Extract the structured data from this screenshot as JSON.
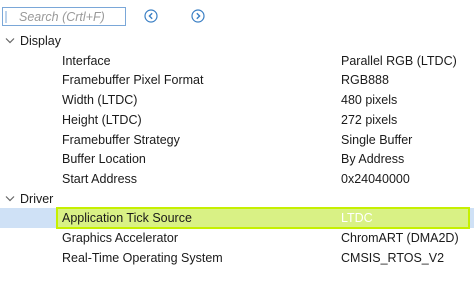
{
  "search": {
    "placeholder": "Search (Crtl+F)"
  },
  "groups": [
    {
      "label": "Display",
      "properties": [
        {
          "name": "Interface",
          "value": "Parallel RGB (LTDC)"
        },
        {
          "name": "Framebuffer Pixel Format",
          "value": "RGB888"
        },
        {
          "name": "Width (LTDC)",
          "value": "480 pixels"
        },
        {
          "name": "Height (LTDC)",
          "value": "272 pixels"
        },
        {
          "name": "Framebuffer Strategy",
          "value": "Single Buffer"
        },
        {
          "name": "Buffer Location",
          "value": "By Address"
        },
        {
          "name": "Start Address",
          "value": "0x24040000"
        }
      ]
    },
    {
      "label": "Driver",
      "properties": [
        {
          "name": "Application Tick Source",
          "value": "LTDC",
          "selected": true
        },
        {
          "name": "Graphics Accelerator",
          "value": "ChromART (DMA2D)"
        },
        {
          "name": "Real-Time Operating System",
          "value": "CMSIS_RTOS_V2"
        }
      ]
    }
  ],
  "colors": {
    "highlight": "#e1ff28",
    "highlight_border": "#c6f000",
    "selection": "#cfe1f6",
    "nav_icon": "#3a7fc4"
  },
  "icons": {
    "search": "search-icon",
    "prev": "circle-chevron-left-icon",
    "next": "circle-chevron-right-icon",
    "expand": "chevron-down-icon"
  }
}
